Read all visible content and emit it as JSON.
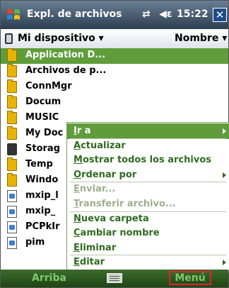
{
  "titlebar": {
    "title": "Expl. de archivos",
    "time": "15:22",
    "connection_glyph": "⇄",
    "volume_glyph": "◀ε",
    "close_glyph": "✕"
  },
  "header": {
    "location": "Mi dispositivo ▾",
    "sort": "Nombre ▾"
  },
  "files": [
    {
      "name": "Application D...",
      "icon": "folder-icon",
      "selected": true
    },
    {
      "name": "Archivos de p...",
      "icon": "folder-icon"
    },
    {
      "name": "ConnMgr",
      "icon": "folder-icon"
    },
    {
      "name": "Docum",
      "icon": "folder-icon"
    },
    {
      "name": "MUSIC",
      "icon": "folder-icon"
    },
    {
      "name": "My Doc",
      "icon": "folder-icon"
    },
    {
      "name": "Storag",
      "icon": "storage-card-icon"
    },
    {
      "name": "Temp",
      "icon": "folder-icon"
    },
    {
      "name": "Windo",
      "icon": "folder-icon"
    },
    {
      "name": "mxip_l",
      "icon": "file-icon"
    },
    {
      "name": "mxip_",
      "icon": "file-icon"
    },
    {
      "name": "PCPkIr",
      "icon": "file-icon"
    },
    {
      "name": "pim",
      "icon": "file-icon"
    }
  ],
  "context_menu": {
    "items": [
      {
        "ul": "I",
        "rest": "r a",
        "submenu": true,
        "highlighted": true
      },
      {
        "ul": "A",
        "rest": "ctualizar"
      },
      {
        "ul": "M",
        "rest": "ostrar todos los archivos"
      },
      {
        "ul": "O",
        "rest": "rdenar por",
        "submenu": true
      },
      {
        "ul": "E",
        "rest": "nviar...",
        "disabled": true
      },
      {
        "ul": "T",
        "rest": "ransferir archivo...",
        "disabled": true
      },
      {
        "ul": "N",
        "rest": "ueva carpeta",
        "pre": ""
      },
      {
        "ul": "C",
        "rest": "ambiar nombre"
      },
      {
        "ul": "E",
        "rest": "liminar"
      },
      {
        "ul": "E",
        "rest": "ditar",
        "submenu": true
      }
    ]
  },
  "bottombar": {
    "left": "Arriba",
    "right": "Menú"
  },
  "colors": {
    "accent": "#5f9c3a",
    "menu_text": "#2e6b1f",
    "titlebar": "#2d3e52",
    "highlight_box": "#dd2233"
  }
}
